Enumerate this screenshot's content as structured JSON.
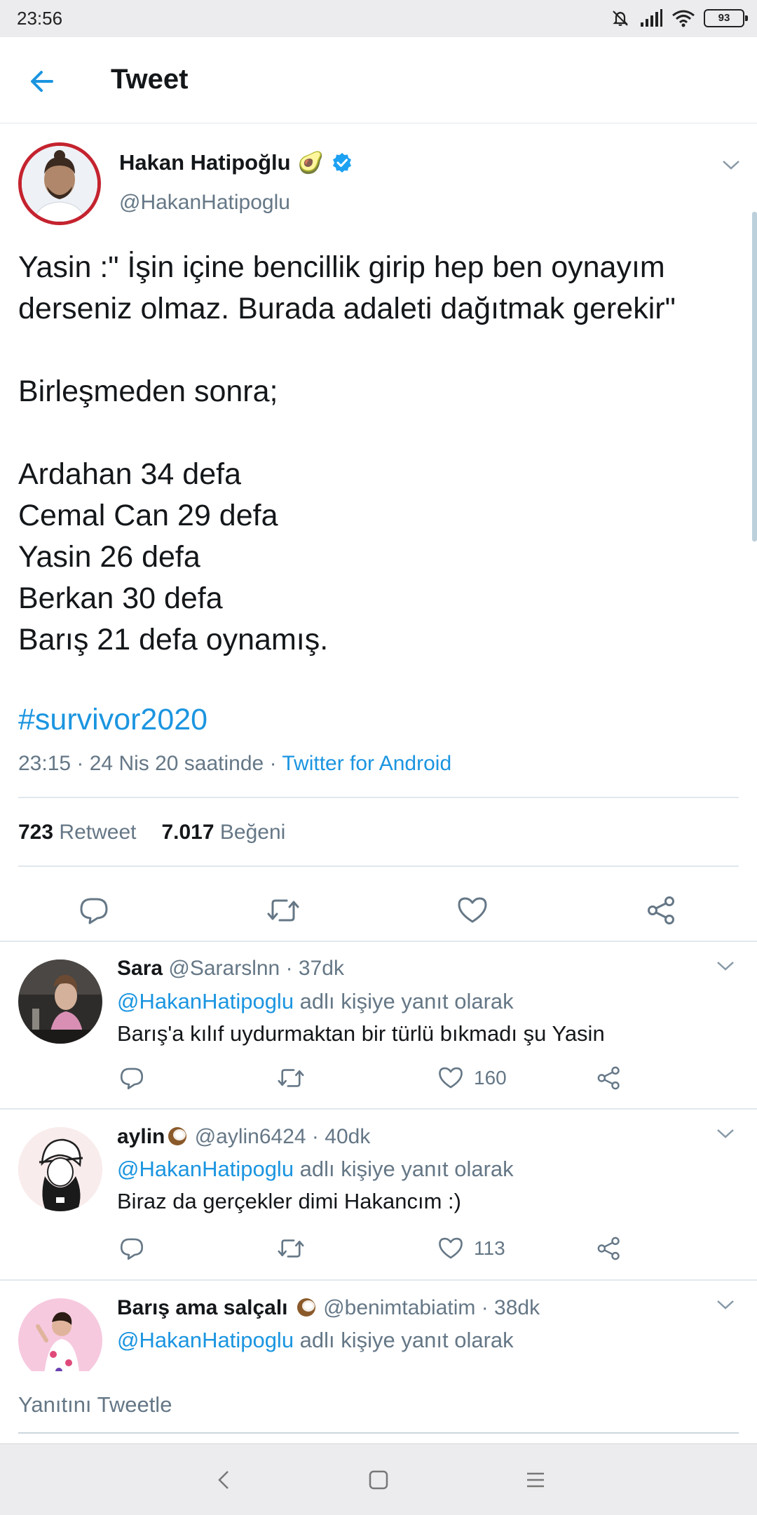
{
  "status_bar": {
    "time": "23:56",
    "battery": "93"
  },
  "header": {
    "title": "Tweet"
  },
  "tweet": {
    "author_name": "Hakan Hatipoğlu",
    "author_emoji": "🥑",
    "author_handle": "@HakanHatipoglu",
    "text_lines": [
      "Yasin :\" İşin içine bencillik girip hep ben oynayım",
      "derseniz olmaz. Burada adaleti dağıtmak gerekir\"",
      "",
      "Birleşmeden sonra;",
      "",
      "Ardahan 34 defa",
      "Cemal Can 29 defa",
      "Yasin 26 defa",
      "Berkan  30 defa",
      "Barış  21 defa oynamış."
    ],
    "hashtag": "#survivor2020",
    "timestamp": "23:15 · 24 Nis 20 saatinde · ",
    "source": "Twitter for Android",
    "retweet_count": "723",
    "retweet_label": "Retweet",
    "like_count": "7.017",
    "like_label": "Beğeni"
  },
  "replies": [
    {
      "name": "Sara",
      "handle_time": " @Sararslnn · 37dk",
      "reply_prefix": "@HakanHatipoglu",
      "reply_suffix": " adlı kişiye yanıt olarak",
      "text": "Barış'a kılıf uydurmaktan bir türlü bıkmadı şu Yasin",
      "likes": "160"
    },
    {
      "name": "aylin",
      "handle_time": " @aylin6424 · 40dk",
      "reply_prefix": "@HakanHatipoglu",
      "reply_suffix": " adlı kişiye yanıt olarak",
      "text": "Biraz da gerçekler dimi Hakancım :)",
      "likes": "113"
    },
    {
      "name": "Barış ama salçalı",
      "handle_time": " @benimtabiatim · 38dk",
      "reply_prefix": "@HakanHatipoglu",
      "reply_suffix": " adlı kişiye yanıt olarak",
      "text": "",
      "likes": ""
    }
  ],
  "compose": {
    "placeholder": "Yanıtını Tweetle"
  },
  "colors": {
    "accent": "#1b95e0",
    "muted": "#657786",
    "text": "#14171a",
    "divider": "#e1e8ed"
  },
  "icons": [
    "back-arrow-icon",
    "verified-badge-icon",
    "chevron-down-icon",
    "reply-icon",
    "retweet-icon",
    "like-icon",
    "share-icon",
    "nav-back-icon",
    "nav-home-icon",
    "nav-menu-icon"
  ]
}
